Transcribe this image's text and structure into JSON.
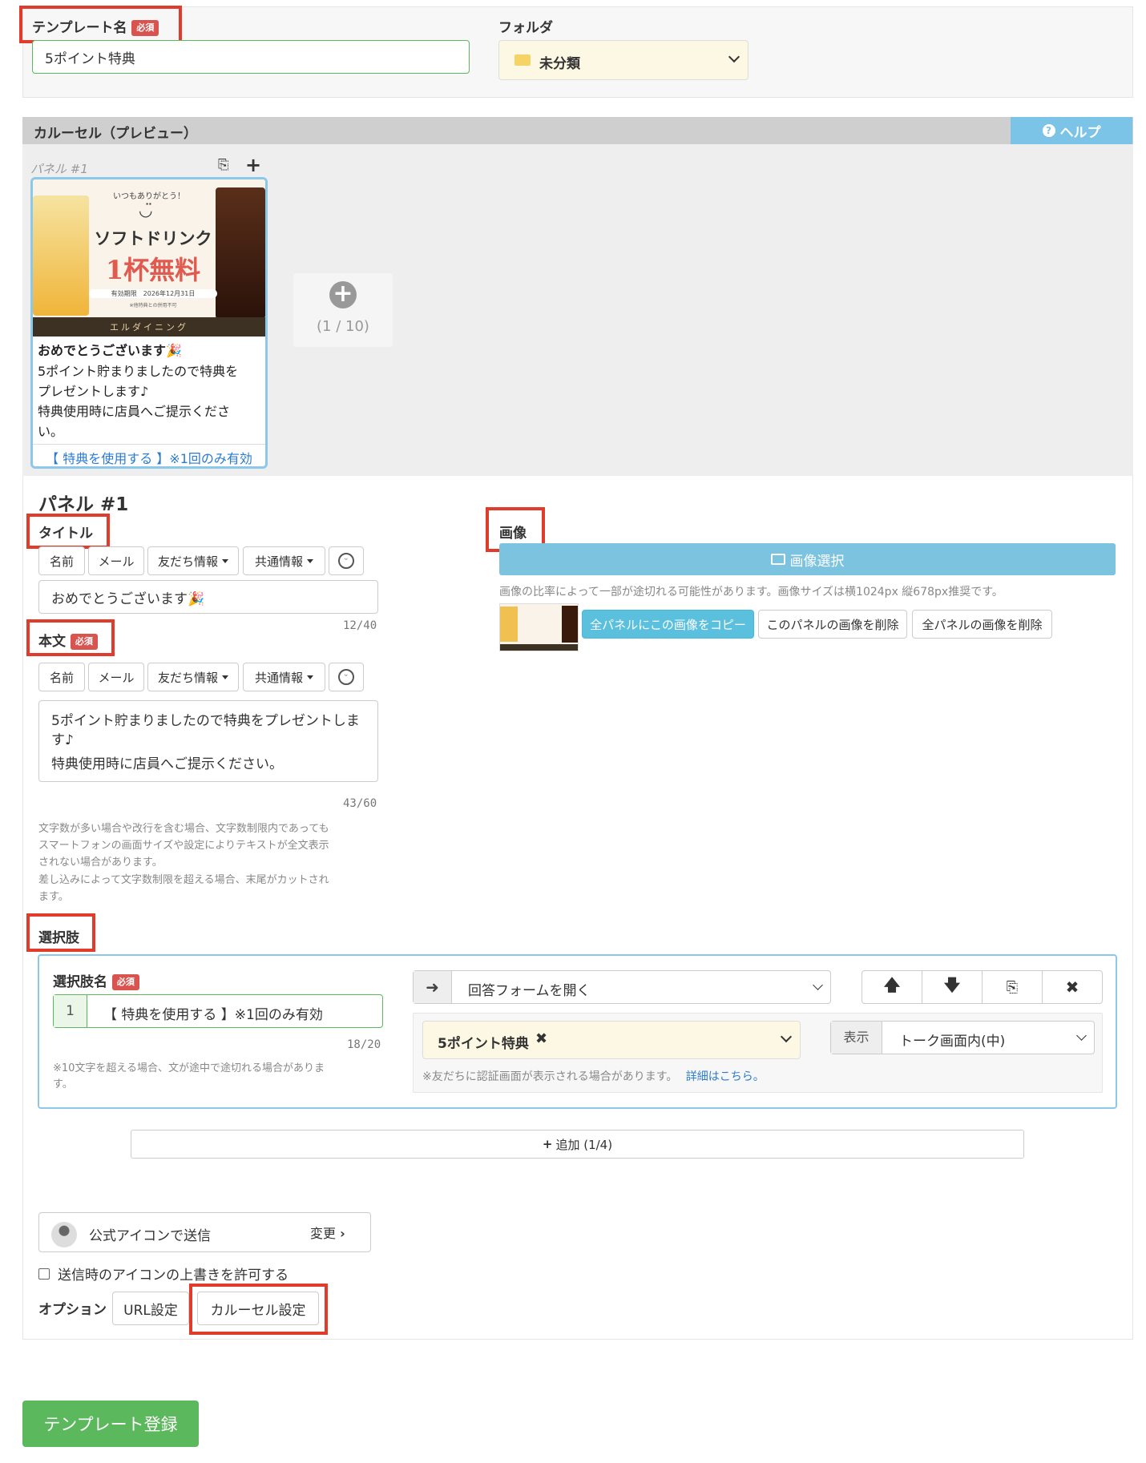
{
  "template": {
    "name_label": "テンプレート名",
    "required": "必須",
    "name_value": "5ポイント特典",
    "folder_label": "フォルダ",
    "folder_value": "未分類"
  },
  "carousel": {
    "header": "カルーセル（プレビュー）",
    "help": "ヘルプ",
    "panel_label": "パネル #1",
    "add_count": "(1 / 10)",
    "preview": {
      "image_top_text": "いつもありがとう！",
      "image_headline": "ソフトドリンク",
      "image_free": "1杯無料",
      "image_expiry": "有効期限　2026年12月31日",
      "image_note": "※他特典との併用不可",
      "image_shop": "エルダイニング",
      "title": "おめでとうございます🎉",
      "body_lines": [
        "5ポイント貯まりましたので特典を",
        "プレゼントします♪",
        "特典使用時に店員へご提示くださ",
        "い。"
      ],
      "action": "【 特典を使用する 】※1回のみ有効"
    }
  },
  "panel": {
    "heading": "パネル #1",
    "title_label": "タイトル",
    "tool_name": "名前",
    "tool_mail": "メール",
    "tool_friend": "友だち情報",
    "tool_common": "共通情報",
    "title_value": "おめでとうございます🎉",
    "title_count": "12/40",
    "body_label": "本文",
    "body_lines": [
      "5ポイント貯まりましたので特典をプレゼントしま",
      "す♪",
      "特典使用時に店員へご提示ください。"
    ],
    "body_count": "43/60",
    "body_note_lines": [
      "文字数が多い場合や改行を含む場合、文字数制限内であっても",
      "スマートフォンの画面サイズや設定によりテキストが全文表示",
      "されない場合があります。",
      "差し込みによって文字数制限を超える場合、末尾がカットされ",
      "ます。"
    ],
    "image_label": "画像",
    "image_select": "画像選択",
    "image_note": "画像の比率によって一部が途切れる可能性があります。画像サイズは横1024px 縦678px推奨です。",
    "copy_all": "全パネルにこの画像をコピー",
    "delete_this": "このパネルの画像を削除",
    "delete_all": "全パネルの画像を削除"
  },
  "choices": {
    "label": "選択肢",
    "name_label": "選択肢名",
    "index": "1",
    "value": "【 特典を使用する 】※1回のみ有効",
    "count": "18/20",
    "note_lines": [
      "※10文字を超える場合、文が途中で途切れる場合がありま",
      "す。"
    ],
    "action": "回答フォームを開く",
    "form": "5ポイント特典",
    "display_label": "表示",
    "display_value": "トーク画面内(中)",
    "auth_note": "※友だちに認証画面が表示される場合があります。",
    "detail_link": "詳細はこちら。",
    "add": "追加 (1/4)"
  },
  "sender": {
    "label": "公式アイコンで送信",
    "change": "変更",
    "allow_override": "送信時のアイコンの上書きを許可する"
  },
  "options": {
    "label": "オプション",
    "url": "URL設定",
    "carousel": "カルーセル設定"
  },
  "submit": "テンプレート登録",
  "colors": {
    "accent_blue": "#5bc0de",
    "submit_green": "#5cb85c",
    "required_red": "#d9534f",
    "highlight_red": "#e03b2b",
    "folder_bg": "#fdf8e4",
    "link_blue": "#2a7bd1"
  }
}
